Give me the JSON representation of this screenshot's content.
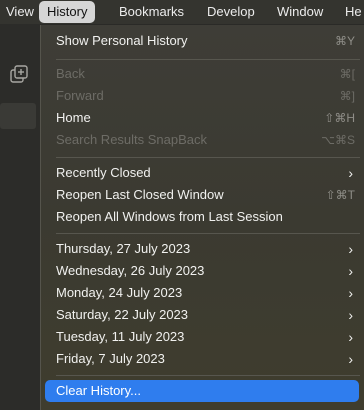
{
  "menubar": {
    "items": [
      "View",
      "History",
      "Bookmarks",
      "Develop",
      "Window",
      "He"
    ],
    "active_index": 1
  },
  "menu": {
    "items": [
      {
        "label": "Show Personal History",
        "shortcut": "⌘Y",
        "enabled": true
      },
      {
        "label": "Back",
        "shortcut": "⌘[",
        "enabled": false
      },
      {
        "label": "Forward",
        "shortcut": "⌘]",
        "enabled": false
      },
      {
        "label": "Home",
        "shortcut": "⇧⌘H",
        "enabled": true
      },
      {
        "label": "Search Results SnapBack",
        "shortcut": "⌥⌘S",
        "enabled": false
      },
      {
        "label": "Recently Closed",
        "submenu": true,
        "enabled": true
      },
      {
        "label": "Reopen Last Closed Window",
        "shortcut": "⇧⌘T",
        "enabled": true
      },
      {
        "label": "Reopen All Windows from Last Session",
        "enabled": true
      },
      {
        "label": "Thursday, 27 July 2023",
        "submenu": true,
        "enabled": true
      },
      {
        "label": "Wednesday, 26 July 2023",
        "submenu": true,
        "enabled": true
      },
      {
        "label": "Monday, 24 July 2023",
        "submenu": true,
        "enabled": true
      },
      {
        "label": "Saturday, 22 July 2023",
        "submenu": true,
        "enabled": true
      },
      {
        "label": "Tuesday, 11 July 2023",
        "submenu": true,
        "enabled": true
      },
      {
        "label": "Friday, 7 July 2023",
        "submenu": true,
        "enabled": true
      },
      {
        "label": "Clear History...",
        "enabled": true,
        "highlighted": true
      }
    ],
    "submenu_glyph": "›"
  },
  "colors": {
    "highlight": "#2f7dee",
    "menubar_active": "#d6d6d6"
  },
  "icons": {
    "sidebar_tab_icon": "tab-overview-icon"
  }
}
